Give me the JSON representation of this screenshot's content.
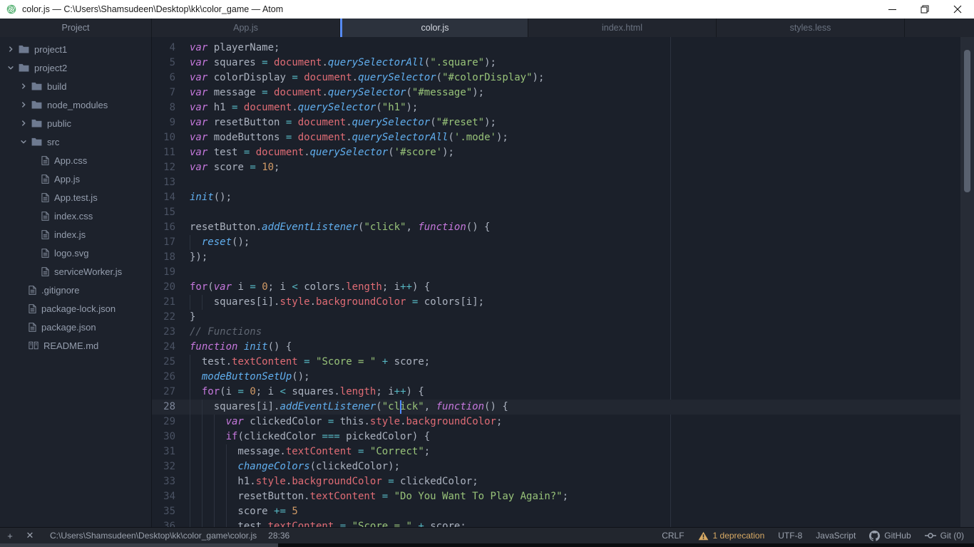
{
  "titlebar": {
    "title": "color.js — C:\\Users\\Shamsudeen\\Desktop\\kk\\color_game — Atom",
    "accent_green": "#5fb57a",
    "controls": {
      "minimize": "—",
      "restore": "❐",
      "close": "✕"
    }
  },
  "tabs": [
    {
      "label": "Project",
      "kind": "project"
    },
    {
      "label": "App.js"
    },
    {
      "label": "color.js",
      "active": true
    },
    {
      "label": "index.html"
    },
    {
      "label": "styles.less"
    }
  ],
  "tree": {
    "items": [
      {
        "name": "project1",
        "type": "folder",
        "depth": 0,
        "expanded": false
      },
      {
        "name": "project2",
        "type": "folder",
        "depth": 0,
        "expanded": true
      },
      {
        "name": "build",
        "type": "folder",
        "depth": 1,
        "expanded": false
      },
      {
        "name": "node_modules",
        "type": "folder",
        "depth": 1,
        "expanded": false
      },
      {
        "name": "public",
        "type": "folder",
        "depth": 1,
        "expanded": false
      },
      {
        "name": "src",
        "type": "folder",
        "depth": 1,
        "expanded": true
      },
      {
        "name": "App.css",
        "type": "file",
        "depth": 2
      },
      {
        "name": "App.js",
        "type": "file",
        "depth": 2
      },
      {
        "name": "App.test.js",
        "type": "file",
        "depth": 2
      },
      {
        "name": "index.css",
        "type": "file",
        "depth": 2
      },
      {
        "name": "index.js",
        "type": "file",
        "depth": 2
      },
      {
        "name": "logo.svg",
        "type": "file",
        "depth": 2
      },
      {
        "name": "serviceWorker.js",
        "type": "file",
        "depth": 2
      },
      {
        "name": ".gitignore",
        "type": "file",
        "depth": 1
      },
      {
        "name": "package-lock.json",
        "type": "file",
        "depth": 1
      },
      {
        "name": "package.json",
        "type": "file",
        "depth": 1
      },
      {
        "name": "README.md",
        "type": "readme",
        "depth": 1
      }
    ]
  },
  "editor": {
    "accent_blue": "#568af2",
    "active_line": 28,
    "cursor": {
      "line": 28,
      "col": 36
    },
    "wrap_guide_col": 80,
    "lines": [
      {
        "n": 4,
        "g": 0,
        "seg": [
          [
            "kwi",
            "var"
          ],
          [
            "txt",
            " playerName;"
          ]
        ]
      },
      {
        "n": 5,
        "g": 0,
        "seg": [
          [
            "kwi",
            "var"
          ],
          [
            "txt",
            " squares "
          ],
          [
            "op",
            "="
          ],
          [
            "txt",
            " "
          ],
          [
            "prop",
            "document"
          ],
          [
            "txt",
            "."
          ],
          [
            "fn",
            "querySelectorAll"
          ],
          [
            "txt",
            "("
          ],
          [
            "str",
            "\".square\""
          ],
          [
            "txt",
            ");"
          ]
        ]
      },
      {
        "n": 6,
        "g": 0,
        "seg": [
          [
            "kwi",
            "var"
          ],
          [
            "txt",
            " colorDisplay "
          ],
          [
            "op",
            "="
          ],
          [
            "txt",
            " "
          ],
          [
            "prop",
            "document"
          ],
          [
            "txt",
            "."
          ],
          [
            "fn",
            "querySelector"
          ],
          [
            "txt",
            "("
          ],
          [
            "str",
            "\"#colorDisplay\""
          ],
          [
            "txt",
            ");"
          ]
        ]
      },
      {
        "n": 7,
        "g": 0,
        "seg": [
          [
            "kwi",
            "var"
          ],
          [
            "txt",
            " message "
          ],
          [
            "op",
            "="
          ],
          [
            "txt",
            " "
          ],
          [
            "prop",
            "document"
          ],
          [
            "txt",
            "."
          ],
          [
            "fn",
            "querySelector"
          ],
          [
            "txt",
            "("
          ],
          [
            "str",
            "\"#message\""
          ],
          [
            "txt",
            ");"
          ]
        ]
      },
      {
        "n": 8,
        "g": 0,
        "seg": [
          [
            "kwi",
            "var"
          ],
          [
            "txt",
            " h1 "
          ],
          [
            "op",
            "="
          ],
          [
            "txt",
            " "
          ],
          [
            "prop",
            "document"
          ],
          [
            "txt",
            "."
          ],
          [
            "fn",
            "querySelector"
          ],
          [
            "txt",
            "("
          ],
          [
            "str",
            "\"h1\""
          ],
          [
            "txt",
            ");"
          ]
        ]
      },
      {
        "n": 9,
        "g": 0,
        "seg": [
          [
            "kwi",
            "var"
          ],
          [
            "txt",
            " resetButton "
          ],
          [
            "op",
            "="
          ],
          [
            "txt",
            " "
          ],
          [
            "prop",
            "document"
          ],
          [
            "txt",
            "."
          ],
          [
            "fn",
            "querySelector"
          ],
          [
            "txt",
            "("
          ],
          [
            "str",
            "\"#reset\""
          ],
          [
            "txt",
            ");"
          ]
        ]
      },
      {
        "n": 10,
        "g": 0,
        "seg": [
          [
            "kwi",
            "var"
          ],
          [
            "txt",
            " modeButtons "
          ],
          [
            "op",
            "="
          ],
          [
            "txt",
            " "
          ],
          [
            "prop",
            "document"
          ],
          [
            "txt",
            "."
          ],
          [
            "fn",
            "querySelectorAll"
          ],
          [
            "txt",
            "("
          ],
          [
            "str",
            "'.mode'"
          ],
          [
            "txt",
            ");"
          ]
        ]
      },
      {
        "n": 11,
        "g": 0,
        "seg": [
          [
            "kwi",
            "var"
          ],
          [
            "txt",
            " test "
          ],
          [
            "op",
            "="
          ],
          [
            "txt",
            " "
          ],
          [
            "prop",
            "document"
          ],
          [
            "txt",
            "."
          ],
          [
            "fn",
            "querySelector"
          ],
          [
            "txt",
            "("
          ],
          [
            "str",
            "'#score'"
          ],
          [
            "txt",
            ");"
          ]
        ]
      },
      {
        "n": 12,
        "g": 0,
        "seg": [
          [
            "kwi",
            "var"
          ],
          [
            "txt",
            " score "
          ],
          [
            "op",
            "="
          ],
          [
            "txt",
            " "
          ],
          [
            "num",
            "10"
          ],
          [
            "txt",
            ";"
          ]
        ]
      },
      {
        "n": 13,
        "g": 0,
        "seg": []
      },
      {
        "n": 14,
        "g": 0,
        "seg": [
          [
            "fn",
            "init"
          ],
          [
            "txt",
            "();"
          ]
        ]
      },
      {
        "n": 15,
        "g": 0,
        "seg": []
      },
      {
        "n": 16,
        "g": 0,
        "seg": [
          [
            "txt",
            "resetButton."
          ],
          [
            "fn",
            "addEventListener"
          ],
          [
            "txt",
            "("
          ],
          [
            "str",
            "\"click\""
          ],
          [
            "txt",
            ", "
          ],
          [
            "kwi",
            "function"
          ],
          [
            "txt",
            "() {"
          ]
        ]
      },
      {
        "n": 17,
        "g": 1,
        "seg": [
          [
            "txt",
            "  "
          ],
          [
            "fn",
            "reset"
          ],
          [
            "txt",
            "();"
          ]
        ]
      },
      {
        "n": 18,
        "g": 0,
        "seg": [
          [
            "txt",
            "});"
          ]
        ]
      },
      {
        "n": 19,
        "g": 0,
        "seg": []
      },
      {
        "n": 20,
        "g": 0,
        "seg": [
          [
            "kw",
            "for"
          ],
          [
            "txt",
            "("
          ],
          [
            "kwi",
            "var"
          ],
          [
            "txt",
            " i "
          ],
          [
            "op",
            "="
          ],
          [
            "txt",
            " "
          ],
          [
            "num",
            "0"
          ],
          [
            "txt",
            "; i "
          ],
          [
            "op",
            "<"
          ],
          [
            "txt",
            " colors."
          ],
          [
            "prop",
            "length"
          ],
          [
            "txt",
            "; i"
          ],
          [
            "op",
            "++"
          ],
          [
            "txt",
            ") {"
          ]
        ]
      },
      {
        "n": 21,
        "g": 2,
        "seg": [
          [
            "txt",
            "    squares[i]."
          ],
          [
            "prop",
            "style"
          ],
          [
            "txt",
            "."
          ],
          [
            "prop",
            "backgroundColor"
          ],
          [
            "txt",
            " "
          ],
          [
            "op",
            "="
          ],
          [
            "txt",
            " colors[i];"
          ]
        ]
      },
      {
        "n": 22,
        "g": 0,
        "seg": [
          [
            "txt",
            "}"
          ]
        ]
      },
      {
        "n": 23,
        "g": 0,
        "seg": [
          [
            "cmt",
            "// Functions"
          ]
        ]
      },
      {
        "n": 24,
        "g": 0,
        "seg": [
          [
            "kwi",
            "function"
          ],
          [
            "txt",
            " "
          ],
          [
            "fn",
            "init"
          ],
          [
            "txt",
            "() {"
          ]
        ]
      },
      {
        "n": 25,
        "g": 1,
        "seg": [
          [
            "txt",
            "  test."
          ],
          [
            "prop",
            "textContent"
          ],
          [
            "txt",
            " "
          ],
          [
            "op",
            "="
          ],
          [
            "txt",
            " "
          ],
          [
            "str",
            "\"Score = \""
          ],
          [
            "txt",
            " "
          ],
          [
            "op",
            "+"
          ],
          [
            "txt",
            " score;"
          ]
        ]
      },
      {
        "n": 26,
        "g": 1,
        "seg": [
          [
            "txt",
            "  "
          ],
          [
            "fn",
            "modeButtonSetUp"
          ],
          [
            "txt",
            "();"
          ]
        ]
      },
      {
        "n": 27,
        "g": 1,
        "seg": [
          [
            "txt",
            "  "
          ],
          [
            "kw",
            "for"
          ],
          [
            "txt",
            "(i "
          ],
          [
            "op",
            "="
          ],
          [
            "txt",
            " "
          ],
          [
            "num",
            "0"
          ],
          [
            "txt",
            "; i "
          ],
          [
            "op",
            "<"
          ],
          [
            "txt",
            " squares."
          ],
          [
            "prop",
            "length"
          ],
          [
            "txt",
            "; i"
          ],
          [
            "op",
            "++"
          ],
          [
            "txt",
            ") {"
          ]
        ]
      },
      {
        "n": 28,
        "g": 2,
        "seg": [
          [
            "txt",
            "    squares[i]."
          ],
          [
            "fn",
            "addEventListener"
          ],
          [
            "txt",
            "("
          ],
          [
            "str",
            "\"click\""
          ],
          [
            "txt",
            ", "
          ],
          [
            "kwi",
            "function"
          ],
          [
            "txt",
            "() {"
          ]
        ]
      },
      {
        "n": 29,
        "g": 3,
        "seg": [
          [
            "txt",
            "      "
          ],
          [
            "kwi",
            "var"
          ],
          [
            "txt",
            " clickedColor "
          ],
          [
            "op",
            "="
          ],
          [
            "txt",
            " this."
          ],
          [
            "prop",
            "style"
          ],
          [
            "txt",
            "."
          ],
          [
            "prop",
            "backgroundColor"
          ],
          [
            "txt",
            ";"
          ]
        ]
      },
      {
        "n": 30,
        "g": 3,
        "seg": [
          [
            "txt",
            "      "
          ],
          [
            "kw",
            "if"
          ],
          [
            "txt",
            "(clickedColor "
          ],
          [
            "op",
            "==="
          ],
          [
            "txt",
            " pickedColor) {"
          ]
        ]
      },
      {
        "n": 31,
        "g": 4,
        "seg": [
          [
            "txt",
            "        message."
          ],
          [
            "prop",
            "textContent"
          ],
          [
            "txt",
            " "
          ],
          [
            "op",
            "="
          ],
          [
            "txt",
            " "
          ],
          [
            "str",
            "\"Correct\""
          ],
          [
            "txt",
            ";"
          ]
        ]
      },
      {
        "n": 32,
        "g": 4,
        "seg": [
          [
            "txt",
            "        "
          ],
          [
            "fn",
            "changeColors"
          ],
          [
            "txt",
            "(clickedColor);"
          ]
        ]
      },
      {
        "n": 33,
        "g": 4,
        "seg": [
          [
            "txt",
            "        h1."
          ],
          [
            "prop",
            "style"
          ],
          [
            "txt",
            "."
          ],
          [
            "prop",
            "backgroundColor"
          ],
          [
            "txt",
            " "
          ],
          [
            "op",
            "="
          ],
          [
            "txt",
            " clickedColor;"
          ]
        ]
      },
      {
        "n": 34,
        "g": 4,
        "seg": [
          [
            "txt",
            "        resetButton."
          ],
          [
            "prop",
            "textContent"
          ],
          [
            "txt",
            " "
          ],
          [
            "op",
            "="
          ],
          [
            "txt",
            " "
          ],
          [
            "str",
            "\"Do You Want To Play Again?\""
          ],
          [
            "txt",
            ";"
          ]
        ]
      },
      {
        "n": 35,
        "g": 4,
        "seg": [
          [
            "txt",
            "        score "
          ],
          [
            "op",
            "+="
          ],
          [
            "txt",
            " "
          ],
          [
            "num",
            "5"
          ]
        ]
      },
      {
        "n": 36,
        "g": 4,
        "seg": [
          [
            "txt",
            "        test."
          ],
          [
            "prop",
            "textContent"
          ],
          [
            "txt",
            " "
          ],
          [
            "op",
            "="
          ],
          [
            "txt",
            " "
          ],
          [
            "str",
            "\"Score = \""
          ],
          [
            "txt",
            " "
          ],
          [
            "op",
            "+"
          ],
          [
            "txt",
            " score;"
          ]
        ]
      }
    ]
  },
  "statusbar": {
    "add_icon": "+",
    "close_icon": "✕",
    "file_path": "C:\\Users\\Shamsudeen\\Desktop\\kk\\color_game\\color.js",
    "cursor_position": "28:36",
    "line_ending": "CRLF",
    "deprecation": "1 deprecation",
    "encoding": "UTF-8",
    "grammar": "JavaScript",
    "github_label": "GitHub",
    "git_label": "Git (0)",
    "warning_color": "#d7a964"
  }
}
